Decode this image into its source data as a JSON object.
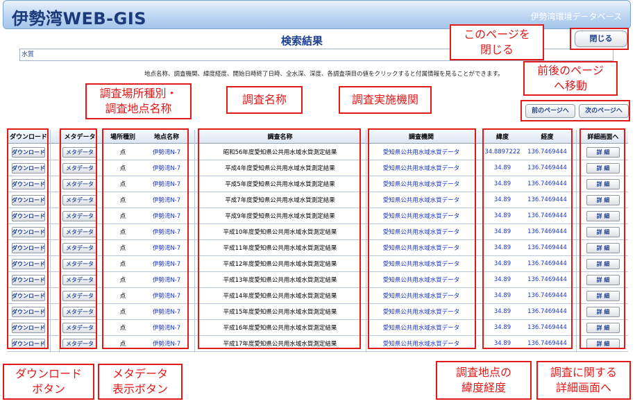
{
  "header": {
    "title": "伊勢湾WEB-GIS",
    "subtitle": "伊勢湾環境データベース"
  },
  "page_title": "検索結果",
  "close_button": "閉じる",
  "query_value": "水質",
  "help_text": "地点名称、調査機関、緯度経度、開始日時終了日時、全水深、深度、各調査項目の値をクリックすると付属情報を見ることができます。",
  "nav": {
    "prev": "前のページへ",
    "next": "次のページへ"
  },
  "table": {
    "headers": {
      "download": "ダウンロード",
      "metadata": "メタデータ",
      "type": "場所種別",
      "point": "地点名称",
      "name": "調査名称",
      "org": "調査機関",
      "lat": "緯度",
      "lon": "経度",
      "detail": "詳細画面へ"
    },
    "download_label": "ダウンロード",
    "metadata_label": "メタデータ",
    "detail_label": "詳 細",
    "rows": [
      {
        "type": "点",
        "point": "伊勢湾N-7",
        "name": "昭和56年度愛知県公共用水域水質測定結果",
        "org": "愛知県公共用水域水質データ",
        "lat": "34.8897222",
        "lon": "136.7469444"
      },
      {
        "type": "点",
        "point": "伊勢湾N-7",
        "name": "平成4年度愛知県公共用水域水質測定結果",
        "org": "愛知県公共用水域水質データ",
        "lat": "34.89",
        "lon": "136.7469444"
      },
      {
        "type": "点",
        "point": "伊勢湾N-7",
        "name": "平成5年度愛知県公共用水域水質測定結果",
        "org": "愛知県公共用水域水質データ",
        "lat": "34.89",
        "lon": "136.7469444"
      },
      {
        "type": "点",
        "point": "伊勢湾N-7",
        "name": "平成7年度愛知県公共用水域水質測定結果",
        "org": "愛知県公共用水域水質データ",
        "lat": "34.89",
        "lon": "136.7469444"
      },
      {
        "type": "点",
        "point": "伊勢湾N-7",
        "name": "平成9年度愛知県公共用水域水質測定結果",
        "org": "愛知県公共用水域水質データ",
        "lat": "34.89",
        "lon": "136.7469444"
      },
      {
        "type": "点",
        "point": "伊勢湾N-7",
        "name": "平成10年度愛知県公共用水域水質測定結果",
        "org": "愛知県公共用水域水質データ",
        "lat": "34.89",
        "lon": "136.7469444"
      },
      {
        "type": "点",
        "point": "伊勢湾N-7",
        "name": "平成11年度愛知県公共用水域水質測定結果",
        "org": "愛知県公共用水域水質データ",
        "lat": "34.89",
        "lon": "136.7469444"
      },
      {
        "type": "点",
        "point": "伊勢湾N-7",
        "name": "平成12年度愛知県公共用水域水質測定結果",
        "org": "愛知県公共用水域水質データ",
        "lat": "34.89",
        "lon": "136.7469444"
      },
      {
        "type": "点",
        "point": "伊勢湾N-7",
        "name": "平成13年度愛知県公共用水域水質測定結果",
        "org": "愛知県公共用水域水質データ",
        "lat": "34.89",
        "lon": "136.7469444"
      },
      {
        "type": "点",
        "point": "伊勢湾N-7",
        "name": "平成14年度愛知県公共用水域水質測定結果",
        "org": "愛知県公共用水域水質データ",
        "lat": "34.89",
        "lon": "136.7469444"
      },
      {
        "type": "点",
        "point": "伊勢湾N-7",
        "name": "平成15年度愛知県公共用水域水質測定結果",
        "org": "愛知県公共用水域水質データ",
        "lat": "34.89",
        "lon": "136.7469444"
      },
      {
        "type": "点",
        "point": "伊勢湾N-7",
        "name": "平成16年度愛知県公共用水域水質測定結果",
        "org": "愛知県公共用水域水質データ",
        "lat": "34.89",
        "lon": "136.7469444"
      },
      {
        "type": "点",
        "point": "伊勢湾N-7",
        "name": "平成17年度愛知県公共用水域水質測定結果",
        "org": "愛知県公共用水域水質データ",
        "lat": "34.89",
        "lon": "136.7469444"
      }
    ]
  },
  "annotations": {
    "close_page": [
      "このページを",
      "閉じる"
    ],
    "nav_page": [
      "前後のページ",
      "へ移動"
    ],
    "location": [
      "調査場所種別・",
      "調査地点名称"
    ],
    "survey_name": [
      "調査名称"
    ],
    "survey_org": [
      "調査実施機関"
    ],
    "download": [
      "ダウンロード",
      "ボタン"
    ],
    "metadata": [
      "メタデータ",
      "表示ボタン"
    ],
    "latlon": [
      "調査地点の",
      "緯度経度"
    ],
    "detail": [
      "調査に関する",
      "詳細画面へ"
    ]
  }
}
